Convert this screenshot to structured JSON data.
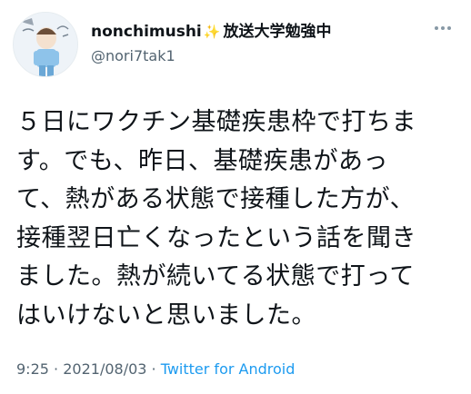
{
  "user": {
    "display_name": "nonchimushi",
    "name_emoji": "✨",
    "name_suffix": "放送大学勉強中",
    "handle": "@nori7tak1",
    "avatar_icon": "user-avatar-icon"
  },
  "menu": {
    "icon": "more-dots-icon"
  },
  "tweet": {
    "lines": [
      "５日にワクチン基礎疾患枠で打ちま",
      "す。でも、昨日、基礎疾患があっ",
      "て、熱がある状態で接種した方が、",
      "接種翌日亡くなったという話を聞き",
      "ました。熱が続いてる状態で打って",
      "はいけないと思いました。"
    ]
  },
  "meta": {
    "time": "9:25",
    "separator": "·",
    "date": "2021/08/03",
    "source": "Twitter for Android"
  },
  "colors": {
    "text": "#0f1419",
    "secondary": "#536471",
    "link": "#1d9bf0"
  }
}
